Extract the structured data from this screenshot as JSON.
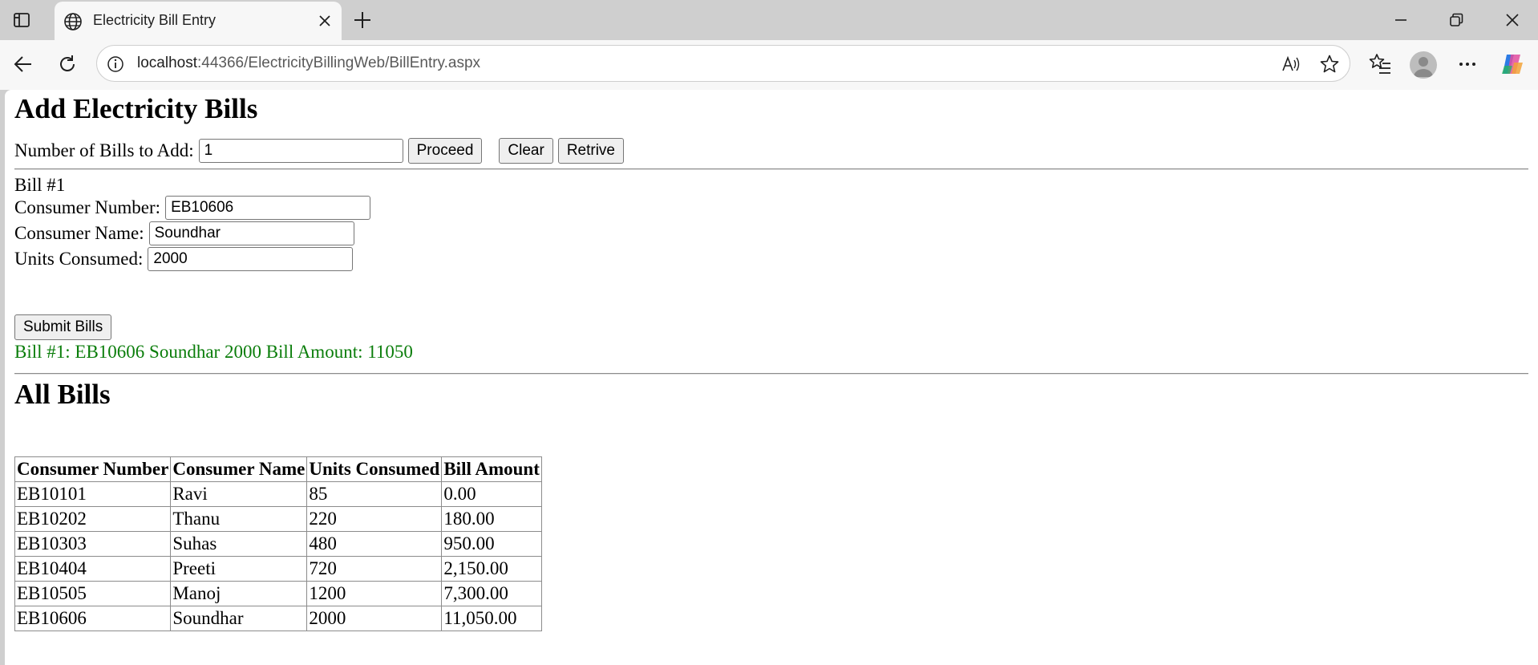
{
  "browser": {
    "tab_title": "Electricity Bill Entry",
    "url_host": "localhost",
    "url_rest": ":44366/ElectricityBillingWeb/BillEntry.aspx"
  },
  "page": {
    "heading": "Add Electricity Bills",
    "num_bills_label": "Number of Bills to Add:",
    "num_bills_value": "1",
    "proceed_label": "Proceed",
    "clear_label": "Clear",
    "retrive_label": "Retrive",
    "bill_header": "Bill #1",
    "consumer_number_label": "Consumer Number:",
    "consumer_number_value": "EB10606",
    "consumer_name_label": "Consumer Name:",
    "consumer_name_value": "Soundhar",
    "units_label": "Units Consumed:",
    "units_value": "2000",
    "submit_label": "Submit Bills",
    "result_message": "Bill #1: EB10606 Soundhar 2000 Bill Amount: 11050",
    "all_bills_heading": "All Bills",
    "success_color": "#0a7d0a"
  },
  "table": {
    "headers": [
      "Consumer Number",
      "Consumer Name",
      "Units Consumed",
      "Bill Amount"
    ],
    "rows": [
      [
        "EB10101",
        "Ravi",
        "85",
        "0.00"
      ],
      [
        "EB10202",
        "Thanu",
        "220",
        "180.00"
      ],
      [
        "EB10303",
        "Suhas",
        "480",
        "950.00"
      ],
      [
        "EB10404",
        "Preeti",
        "720",
        "2,150.00"
      ],
      [
        "EB10505",
        "Manoj",
        "1200",
        "7,300.00"
      ],
      [
        "EB10606",
        "Soundhar",
        "2000",
        "11,050.00"
      ]
    ]
  },
  "icons": {
    "tab_actions": "tab-actions-icon",
    "favicon": "globe-icon",
    "close_tab": "close-icon",
    "new_tab": "plus-icon",
    "minimize": "minimize-icon",
    "restore": "restore-icon",
    "close_window": "close-icon",
    "back": "back-arrow-icon",
    "refresh": "refresh-icon",
    "site_info": "info-icon",
    "read_aloud": "read-aloud-icon",
    "favorite": "star-icon",
    "favorites": "favorites-list-icon",
    "profile": "profile-avatar",
    "more": "more-icon",
    "copilot": "copilot-icon"
  }
}
